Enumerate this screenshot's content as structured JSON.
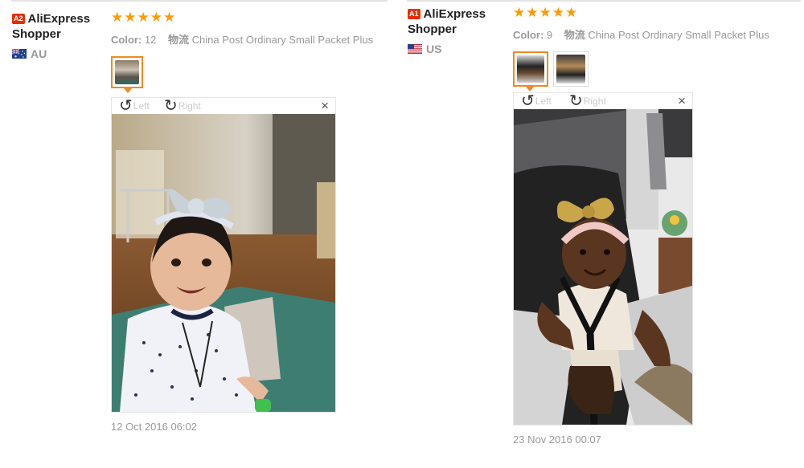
{
  "reviews": [
    {
      "badge": "A2",
      "user_name": "AliExpress Shopper",
      "country": "AU",
      "rating": 5,
      "color_label": "Color:",
      "color_value": "12",
      "shipping_label": "物流",
      "shipping_value": "China Post Ordinary Small Packet Plus",
      "rotate_left": "Left",
      "rotate_right": "Right",
      "close": "×",
      "date": "12 Oct 2016 06:02"
    },
    {
      "badge": "A1",
      "user_name": "AliExpress Shopper",
      "country": "US",
      "rating": 5,
      "color_label": "Color:",
      "color_value": "9",
      "shipping_label": "物流",
      "shipping_value": "China Post Ordinary Small Packet Plus",
      "rotate_left": "Left",
      "rotate_right": "Right",
      "close": "×",
      "date": "23 Nov 2016 00:07"
    }
  ],
  "icons": {
    "star": "star-icon",
    "rotate_left": "rotate-left-icon",
    "rotate_right": "rotate-right-icon",
    "close": "close-icon",
    "flag_au": "australia-flag-icon",
    "flag_us": "usa-flag-icon"
  },
  "colors": {
    "star": "#ff9a00",
    "badge": "#e62e04",
    "selected_thumb": "#f08a24",
    "muted_text": "#999999"
  }
}
